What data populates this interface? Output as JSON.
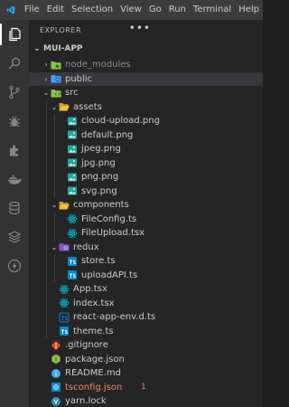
{
  "menu": [
    "File",
    "Edit",
    "Selection",
    "View",
    "Go",
    "Run",
    "Terminal",
    "Help"
  ],
  "activity_icons": [
    "files-icon",
    "search-icon",
    "source-control-icon",
    "debug-icon",
    "extensions-icon",
    "docker-icon",
    "database-icon",
    "stack-icon",
    "lightning-icon"
  ],
  "explorer": {
    "title": "EXPLORER",
    "more": "•••",
    "project": "MUI-APP"
  },
  "tree": [
    {
      "label": "node_modules",
      "depth": 1,
      "chev": "›",
      "icon": "folder-node-icon",
      "style": "dim"
    },
    {
      "label": "public",
      "depth": 1,
      "chev": "›",
      "icon": "folder-public-icon",
      "style": "highlight"
    },
    {
      "label": "src",
      "depth": 1,
      "chev": "⌄",
      "icon": "folder-src-icon",
      "style": ""
    },
    {
      "label": "assets",
      "depth": 2,
      "chev": "⌄",
      "icon": "folder-open-icon",
      "style": ""
    },
    {
      "label": "cloud-upload.png",
      "depth": 3,
      "chev": "",
      "icon": "image-file-icon",
      "style": ""
    },
    {
      "label": "default.png",
      "depth": 3,
      "chev": "",
      "icon": "image-file-icon",
      "style": ""
    },
    {
      "label": "jpeg.png",
      "depth": 3,
      "chev": "",
      "icon": "image-file-icon",
      "style": ""
    },
    {
      "label": "jpg.png",
      "depth": 3,
      "chev": "",
      "icon": "image-file-icon",
      "style": ""
    },
    {
      "label": "png.png",
      "depth": 3,
      "chev": "",
      "icon": "image-file-icon",
      "style": ""
    },
    {
      "label": "svg.png",
      "depth": 3,
      "chev": "",
      "icon": "image-file-icon",
      "style": ""
    },
    {
      "label": "components",
      "depth": 2,
      "chev": "⌄",
      "icon": "folder-open-icon",
      "style": ""
    },
    {
      "label": "FileConfig.ts",
      "depth": 3,
      "chev": "",
      "icon": "react-file-icon",
      "style": ""
    },
    {
      "label": "FileUpload.tsx",
      "depth": 3,
      "chev": "",
      "icon": "react-file-icon",
      "style": ""
    },
    {
      "label": "redux",
      "depth": 2,
      "chev": "⌄",
      "icon": "folder-redux-icon",
      "style": ""
    },
    {
      "label": "store.ts",
      "depth": 3,
      "chev": "",
      "icon": "typescript-file-icon",
      "style": ""
    },
    {
      "label": "uploadAPI.ts",
      "depth": 3,
      "chev": "",
      "icon": "typescript-file-icon",
      "style": ""
    },
    {
      "label": "App.tsx",
      "depth": 2,
      "chev": "",
      "icon": "react-file-icon",
      "style": ""
    },
    {
      "label": "index.tsx",
      "depth": 2,
      "chev": "",
      "icon": "react-file-icon",
      "style": ""
    },
    {
      "label": "react-app-env.d.ts",
      "depth": 2,
      "chev": "",
      "icon": "typescript-def-file-icon",
      "style": ""
    },
    {
      "label": "theme.ts",
      "depth": 2,
      "chev": "",
      "icon": "typescript-file-icon",
      "style": ""
    },
    {
      "label": ".gitignore",
      "depth": 1,
      "chev": "",
      "icon": "git-file-icon",
      "style": ""
    },
    {
      "label": "package.json",
      "depth": 1,
      "chev": "",
      "icon": "node-file-icon",
      "style": ""
    },
    {
      "label": "README.md",
      "depth": 1,
      "chev": "",
      "icon": "info-file-icon",
      "style": ""
    },
    {
      "label": "tsconfig.json",
      "depth": 1,
      "chev": "",
      "icon": "tsconfig-file-icon",
      "style": "error",
      "badge": "1"
    },
    {
      "label": "yarn.lock",
      "depth": 1,
      "chev": "",
      "icon": "yarn-file-icon",
      "style": ""
    }
  ],
  "colors": {
    "accent": "#007acc",
    "folder": "#8bc34a",
    "folder_blue": "#42a5f5",
    "image": "#26a69a",
    "react": "#00bcd4",
    "typescript": "#0288d1",
    "error": "#f48771"
  }
}
